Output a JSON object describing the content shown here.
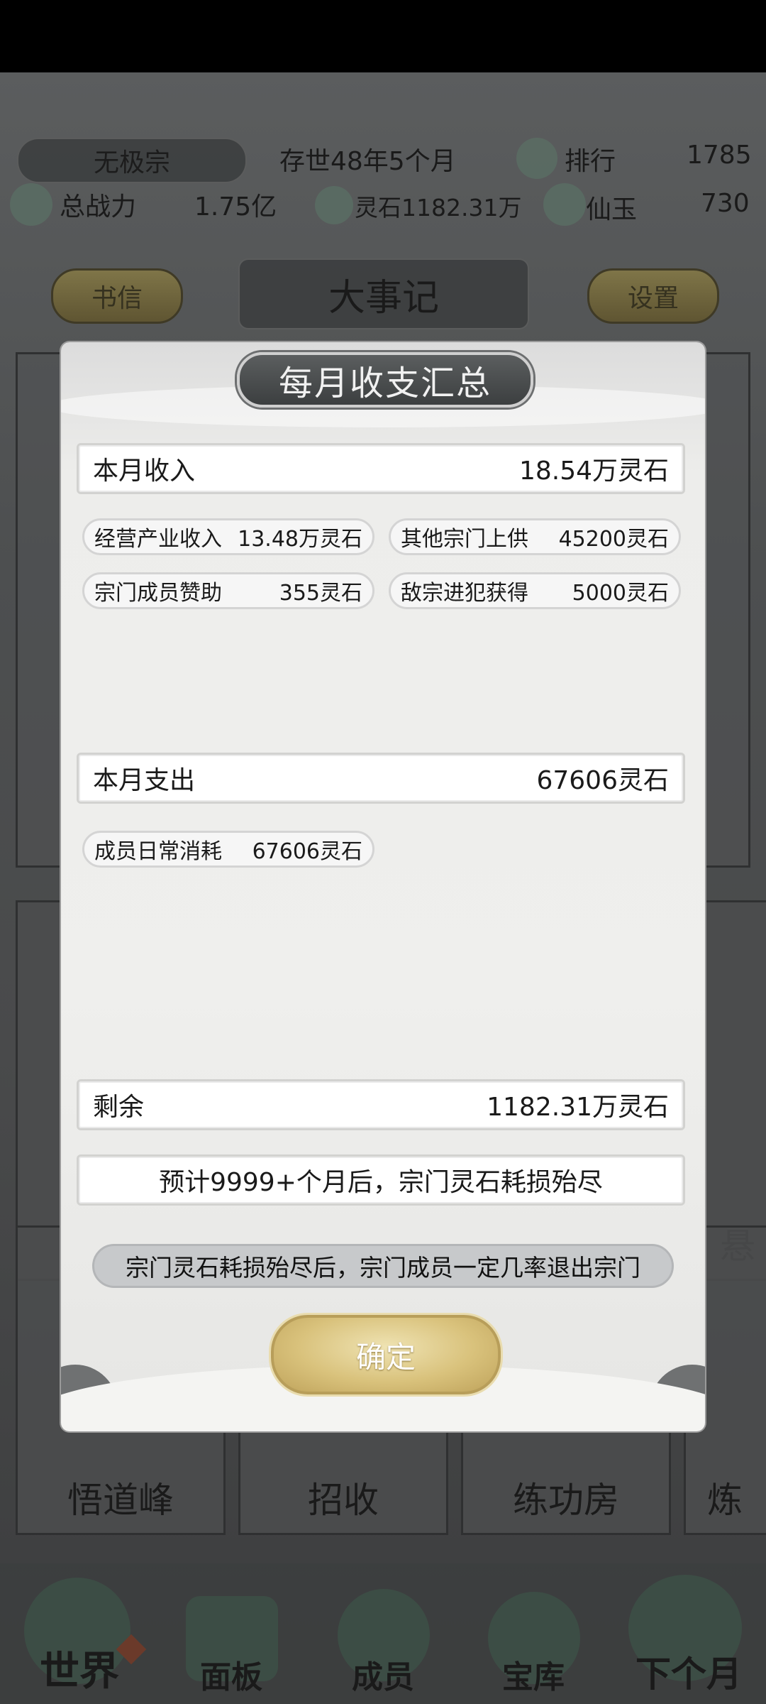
{
  "header": {
    "sect_name": "无极宗",
    "age": "存世48年5个月",
    "rank_label": "排行",
    "rank_value": "1785",
    "power_label": "总战力",
    "power_value": "1.75亿",
    "spirit_stone": "灵石1182.31万",
    "jade_label": "仙玉",
    "jade_value": "730"
  },
  "top_buttons": {
    "letters": "书信",
    "events": "大事记",
    "settings": "设置"
  },
  "background_cards": {
    "row2": [
      "悟道峰",
      "招收",
      "练功房",
      "炼"
    ],
    "right_edge": "悬"
  },
  "bottom_nav": [
    "世界",
    "面板",
    "成员",
    "宝库",
    "下个月"
  ],
  "dialog": {
    "title": "每月收支汇总",
    "income": {
      "label": "本月收入",
      "value": "18.54万灵石",
      "items": [
        {
          "label": "经营产业收入",
          "value": "13.48万灵石"
        },
        {
          "label": "其他宗门上供",
          "value": "45200灵石"
        },
        {
          "label": "宗门成员赞助",
          "value": "355灵石"
        },
        {
          "label": "敌宗进犯获得",
          "value": "5000灵石"
        }
      ]
    },
    "expense": {
      "label": "本月支出",
      "value": "67606灵石",
      "items": [
        {
          "label": "成员日常消耗",
          "value": "67606灵石"
        }
      ]
    },
    "remaining": {
      "label": "剩余",
      "value": "1182.31万灵石"
    },
    "forecast": "预计9999+个月后，宗门灵石耗损殆尽",
    "warning": "宗门灵石耗损殆尽后，宗门成员一定几率退出宗门",
    "confirm": "确定"
  }
}
